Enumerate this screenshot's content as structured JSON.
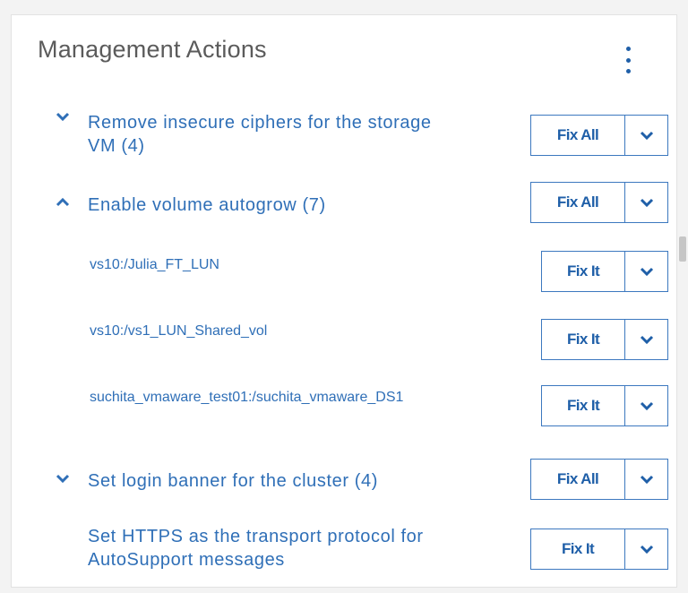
{
  "panel": {
    "title": "Management Actions",
    "menu_icon": "vertical-ellipsis-icon"
  },
  "actions": [
    {
      "label_line1": "Remove insecure ciphers for the storage",
      "label_line2": "VM (4)",
      "expanded": false,
      "button": "Fix All"
    },
    {
      "label_line1": "Enable volume autogrow (7)",
      "expanded": true,
      "button": "Fix All",
      "items": [
        {
          "label": "vs10:/Julia_FT_LUN",
          "button": "Fix It"
        },
        {
          "label": "vs10:/vs1_LUN_Shared_vol",
          "button": "Fix It"
        },
        {
          "label": "suchita_vmaware_test01:/suchita_vmaware_DS1",
          "button": "Fix It"
        }
      ]
    },
    {
      "label_line1": "Set login banner for the cluster (4)",
      "expanded": false,
      "button": "Fix All"
    },
    {
      "label_line1": "Set HTTPS as the transport protocol for",
      "label_line2": "AutoSupport messages",
      "button": "Fix It"
    }
  ],
  "colors": {
    "link_blue": "#2f6fb7",
    "button_border": "#3c78bf",
    "title_gray": "#5b5b5b"
  }
}
